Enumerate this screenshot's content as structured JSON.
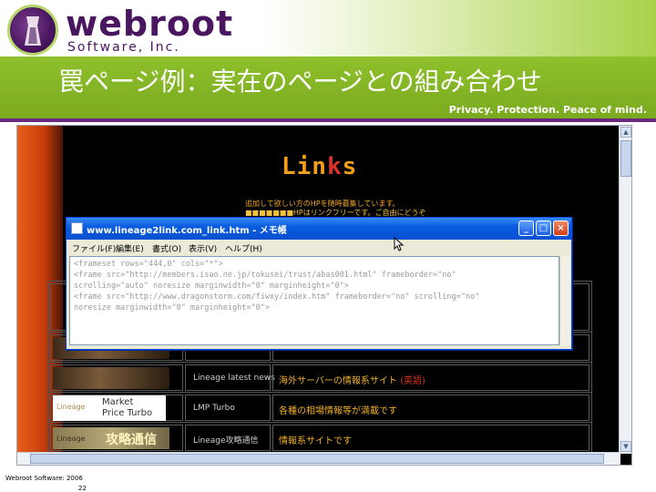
{
  "header": {
    "brand": "webroot",
    "brand_sub": "Software, Inc.",
    "title": "罠ページ例：実在のページとの組み合わせ",
    "tagline": "Privacy. Protection. Peace of mind."
  },
  "browser": {
    "page_title": "Links",
    "info_line1": "追加して欲しい方のHPを随時募集しています。",
    "info_line2": "■■■■■■■HPはリンクフリーです。ご自由にどうぞ",
    "rows": [
      {
        "name": "Lineage latest news",
        "desc": "海外サーバーの情報系サイト",
        "tag": "(英語)"
      },
      {
        "name": "LMP Turbo",
        "desc": "各種の相場情報等が満載です",
        "tag": ""
      },
      {
        "name": "Lineage攻略通信",
        "desc": "情報系サイトです",
        "tag": ""
      }
    ],
    "banner_market": "Market\nPrice Turbo",
    "banner_market_logo": "Lineage",
    "banner_kouryaku": "攻略通信",
    "banner_kouryaku_logo": "Lineage"
  },
  "notepad": {
    "title": "www.lineage2link.com_link.htm - メモ帳",
    "menu": [
      "ファイル(F)",
      "編集(E)",
      "書式(O)",
      "表示(V)",
      "ヘルプ(H)"
    ],
    "lines": [
      "<frameset rows=\"444,0\" cols=\"*\">",
      "<frame src=\"http://members.isao.ne.jp/tokusei/trust/abas001.html\" frameborder=\"no\"",
      "scrolling=\"auto\" noresize marginwidth=\"0\" marginheight=\"0\">",
      "<frame src=\"http://www.dragonstorm.com/fiwxy/index.htm\" frameborder=\"no\" scrolling=\"no\"",
      "noresize marginwidth=\"0\" marginheight=\"0\">"
    ],
    "btn_min": "_",
    "btn_max": "□",
    "btn_close": "×"
  },
  "footer": {
    "copyright": "Webroot Software: 2006",
    "page": "22"
  },
  "colors": {
    "header_green": "#8bbd2a",
    "brand_purple": "#4a1660",
    "link_orange": "#f2b024"
  }
}
